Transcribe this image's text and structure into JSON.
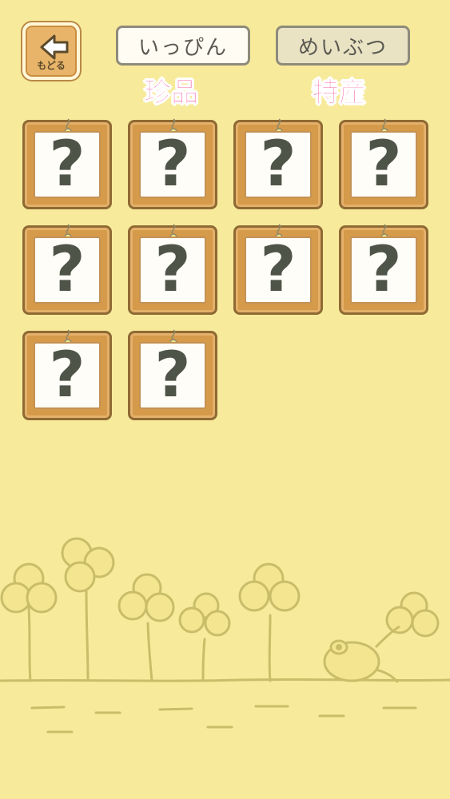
{
  "header": {
    "back_label": "もどる",
    "tabs": [
      {
        "label": "いっぴん",
        "caption": "珍品"
      },
      {
        "label": "めいぶつ",
        "caption": "特産"
      }
    ]
  },
  "grid": {
    "items": [
      {
        "symbol": "?"
      },
      {
        "symbol": "?"
      },
      {
        "symbol": "?"
      },
      {
        "symbol": "?"
      },
      {
        "symbol": "?"
      },
      {
        "symbol": "?"
      },
      {
        "symbol": "?"
      },
      {
        "symbol": "?"
      },
      {
        "symbol": "?"
      },
      {
        "symbol": "?"
      }
    ]
  },
  "colors": {
    "background": "#f7eb9b",
    "caption": "#f0207c",
    "card_frame": "#d59a4a",
    "scene_line": "#c9bd6a"
  },
  "icons": {
    "back": "arrow-left-icon",
    "card_hook": "hook-icon",
    "scenery": "clover-icon"
  }
}
